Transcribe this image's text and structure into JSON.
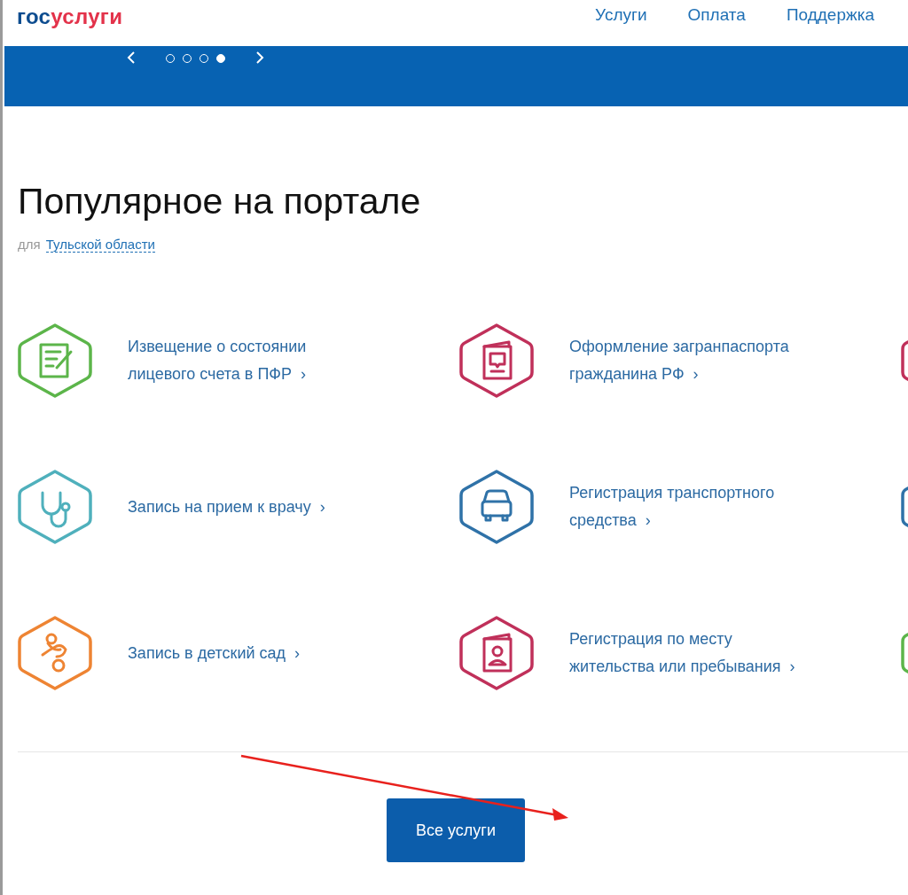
{
  "header": {
    "logo": {
      "part_1": "гос",
      "part_2": "услуги"
    },
    "nav": [
      "Услуги",
      "Оплата",
      "Поддержка"
    ]
  },
  "banner": {
    "dots": [
      {
        "selected": false
      },
      {
        "selected": false
      },
      {
        "selected": false
      },
      {
        "selected": true
      }
    ]
  },
  "popular": {
    "title": "Популярное на портале",
    "region_prefix": "для",
    "region": "Тульской области",
    "rows": [
      {
        "services": [
          {
            "kind": "document",
            "color": "#5cb54a",
            "label": "Извещение о состоянии лицевого счета в ПФР",
            "arrow": "›"
          },
          {
            "kind": "passport",
            "color": "#c0305a",
            "label": "Оформление загранпаспорта гражданина РФ",
            "arrow": "›"
          },
          {
            "kind": "partial",
            "color": "#c0305a"
          }
        ]
      },
      {
        "services": [
          {
            "kind": "stethoscope",
            "color": "#4fb0bc",
            "label": "Запись на прием к врачу",
            "arrow": "›"
          },
          {
            "kind": "car",
            "color": "#2f72a8",
            "label": "Регистрация транспортного средства",
            "arrow": "›"
          },
          {
            "kind": "partial",
            "color": "#2f72a8"
          }
        ]
      },
      {
        "services": [
          {
            "kind": "pacifier",
            "color": "#ee8433",
            "label": "Запись в детский сад",
            "arrow": "›"
          },
          {
            "kind": "id",
            "color": "#c0305a",
            "label": "Регистрация по месту жительства или пребывания",
            "arrow": "›"
          },
          {
            "kind": "partial",
            "color": "#5cb54a"
          }
        ]
      }
    ],
    "all_button": "Все услуги"
  }
}
